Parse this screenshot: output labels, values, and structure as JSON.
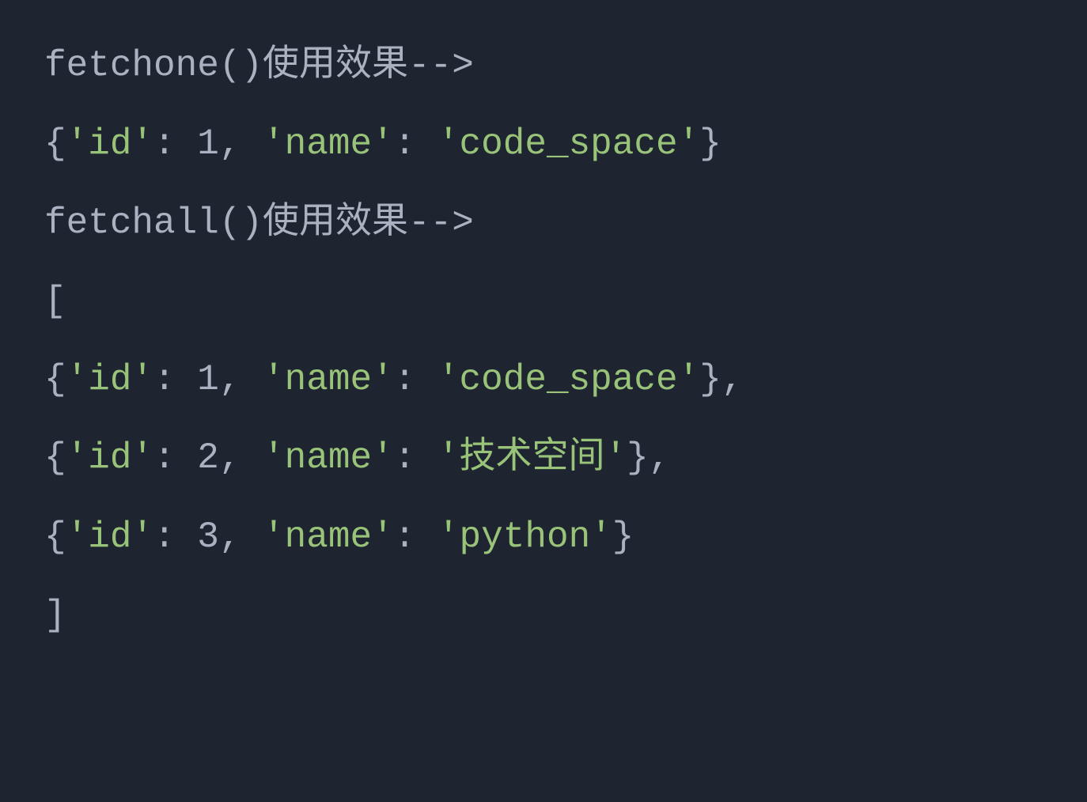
{
  "code": {
    "line1": {
      "text": "fetchone()使用效果-->"
    },
    "line2": {
      "open_brace": "{",
      "key1": "'id'",
      "colon1": ": ",
      "val1": "1",
      "comma1": ", ",
      "key2": "'name'",
      "colon2": ": ",
      "val2": "'code_space'",
      "close_brace": "}"
    },
    "line3": {
      "text": "fetchall()使用效果-->"
    },
    "line4": {
      "bracket": "["
    },
    "line5": {
      "open_brace": "{",
      "key1": "'id'",
      "colon1": ": ",
      "val1": "1",
      "comma1": ", ",
      "key2": "'name'",
      "colon2": ": ",
      "val2": "'code_space'",
      "close_brace": "}",
      "trailing": ","
    },
    "line6": {
      "open_brace": "{",
      "key1": "'id'",
      "colon1": ": ",
      "val1": "2",
      "comma1": ", ",
      "key2": "'name'",
      "colon2": ": ",
      "val2": "'技术空间'",
      "close_brace": "}",
      "trailing": ","
    },
    "line7": {
      "open_brace": "{",
      "key1": "'id'",
      "colon1": ": ",
      "val1": "3",
      "comma1": ", ",
      "key2": "'name'",
      "colon2": ": ",
      "val2": "'python'",
      "close_brace": "}"
    },
    "line8": {
      "bracket": "]"
    }
  }
}
